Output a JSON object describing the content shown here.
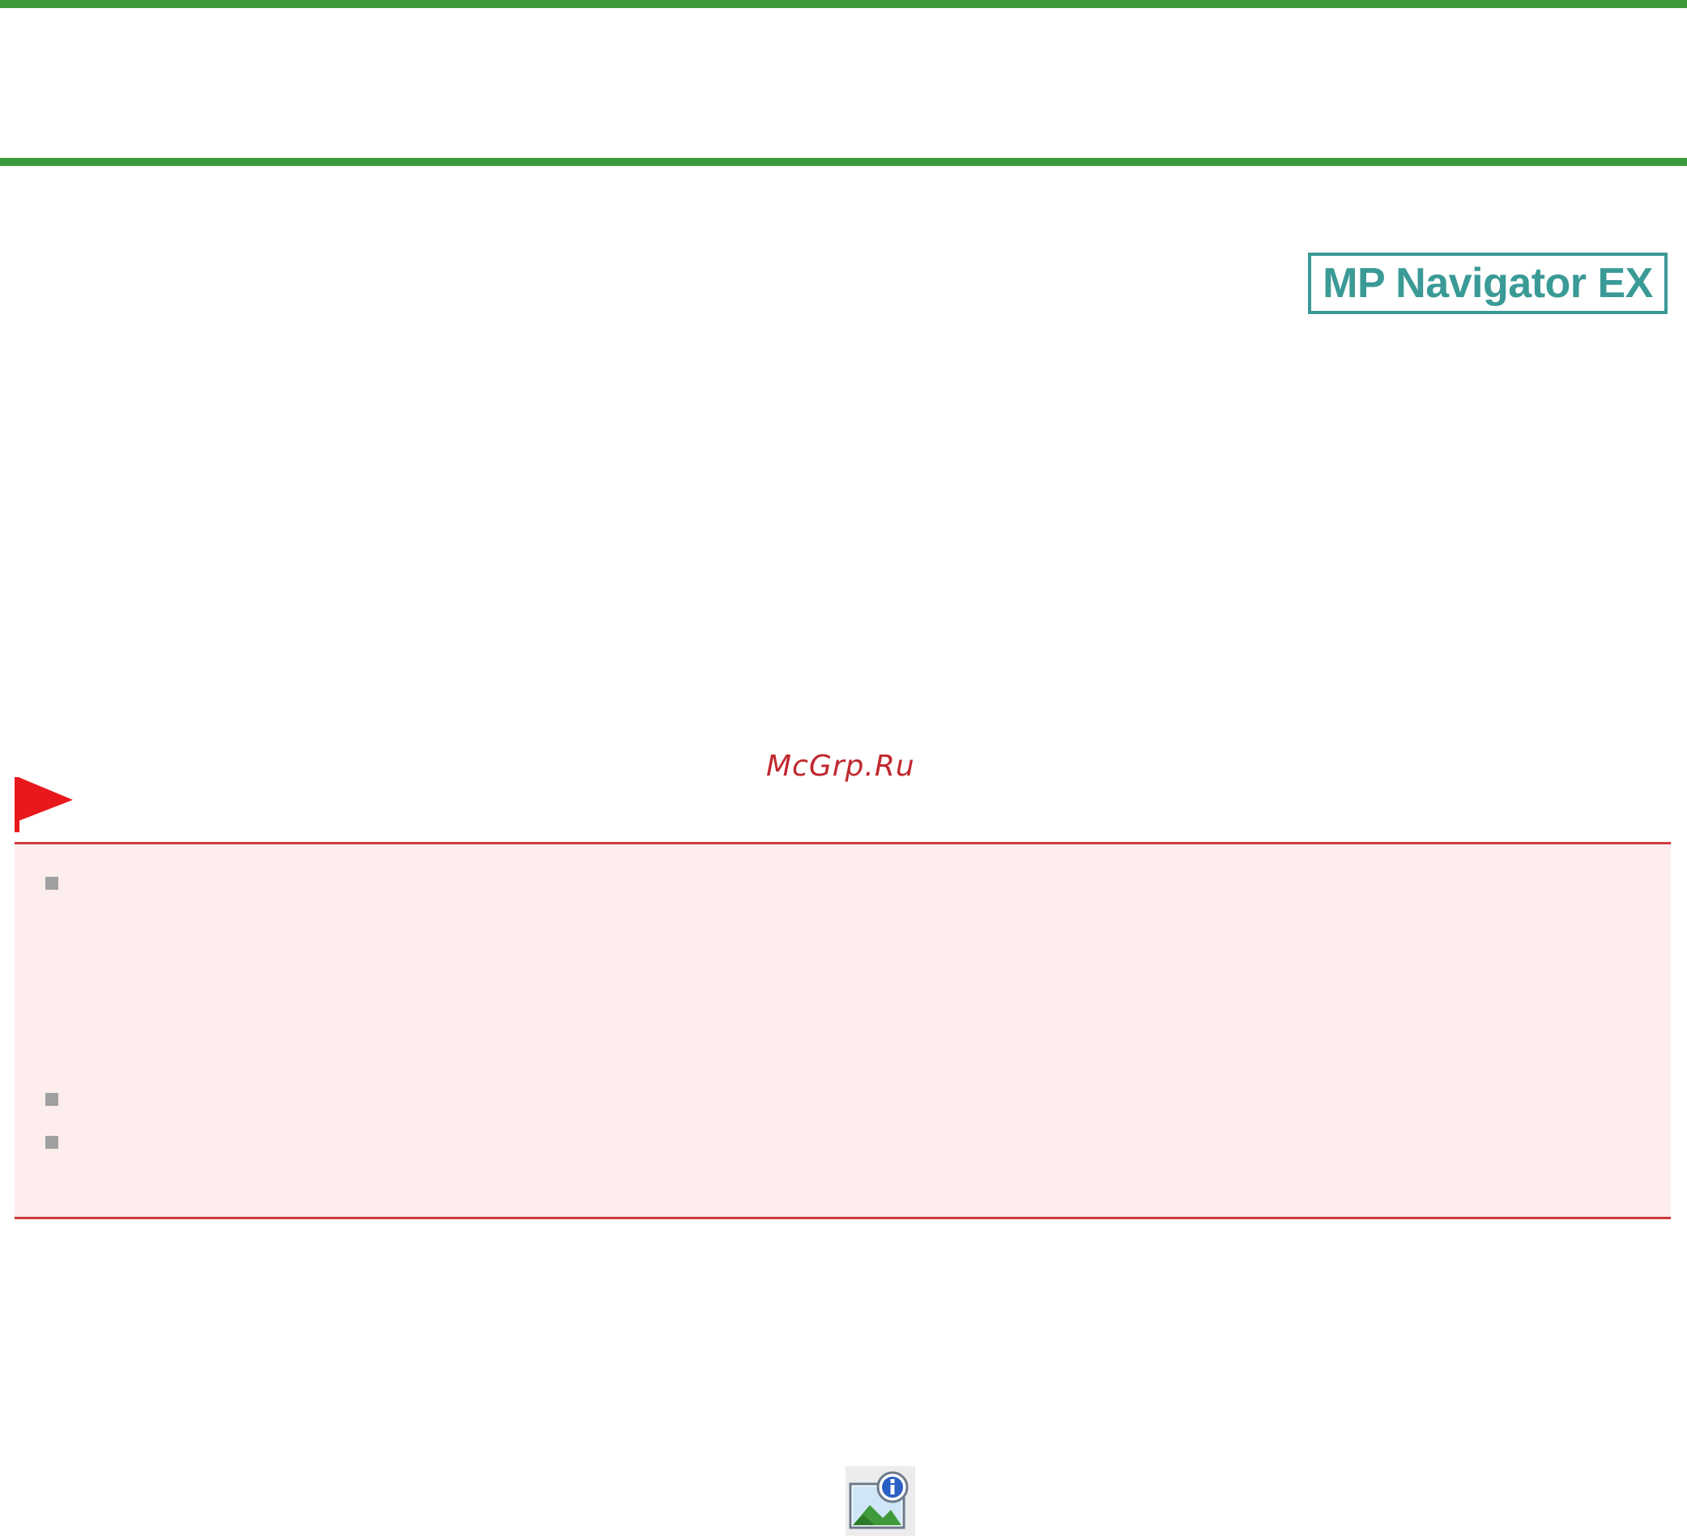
{
  "header": {
    "accent_color": "#3d9a3c"
  },
  "product_badge": {
    "label": "MP Navigator EX",
    "color": "#3a9a96"
  },
  "watermark": {
    "text": "McGrp.Ru",
    "color": "#c0272d"
  },
  "important_section": {
    "flag_icon": "red-flag-icon",
    "flag_color": "#e8181c",
    "border_color": "#d03a3e",
    "background_color": "#fdeded",
    "bullet_count": 3,
    "bullet_icon": "gray-square-bullet-icon"
  },
  "toolbar_icon": {
    "icon": "image-info-icon"
  }
}
